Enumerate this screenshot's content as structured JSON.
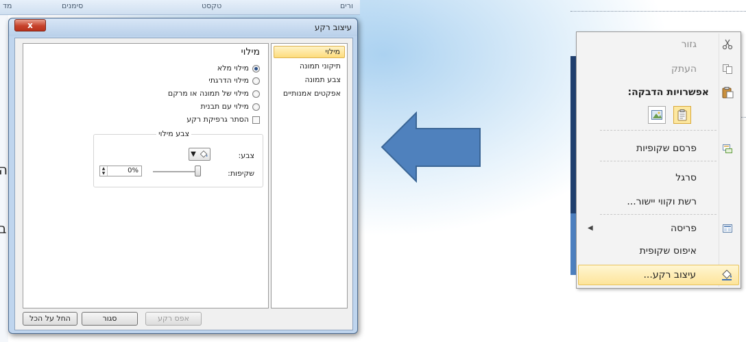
{
  "background": {
    "top_columns": [
      "מד",
      "סימנים",
      "טקסט",
      "ורים"
    ],
    "left_glyphs": [
      "ה",
      "ב"
    ]
  },
  "dialog": {
    "title": "עיצוב רקע",
    "close_glyph": "x",
    "sidebar": {
      "items": [
        {
          "label": "מילוי",
          "selected": true
        },
        {
          "label": "תיקוני תמונה",
          "selected": false
        },
        {
          "label": "צבע תמונה",
          "selected": false
        },
        {
          "label": "אפקטים אמנותיים",
          "selected": false
        }
      ]
    },
    "fill": {
      "heading": "מילוי",
      "options": [
        {
          "label": "מילוי מלא",
          "checked": true
        },
        {
          "label": "מילוי הדרגתי",
          "checked": false
        },
        {
          "label": "מילוי של תמונה או מרקם",
          "checked": false
        },
        {
          "label": "מילוי עם תבנית",
          "checked": false
        }
      ],
      "hide_graphics_label": "הסתר גרפיקת רקע",
      "hide_graphics_checked": false,
      "color_group_title": "צבע מילוי",
      "color_label": "צבע:",
      "color_icon": "paint-bucket-icon",
      "transparency_label": "שקיפות:",
      "transparency_value": "0%",
      "transparency_fraction": 0
    },
    "buttons": {
      "reset": "אפס רקע",
      "close": "סגור",
      "apply_all": "החל על הכל"
    }
  },
  "context_menu": {
    "items": [
      {
        "label": "גזור",
        "icon": "scissors-icon",
        "disabled": true
      },
      {
        "label": "העתק",
        "icon": "copy-icon",
        "disabled": true
      },
      {
        "label": "אפשרויות הדבקה:",
        "icon": "clipboard-icon",
        "bold": true
      },
      {
        "label": "פרסם שקופיות",
        "icon": "publish-icon"
      },
      {
        "label": "סרגל"
      },
      {
        "label": "רשת וקווי יישור..."
      },
      {
        "label": "פריסה",
        "icon": "layout-icon",
        "has_submenu": true
      },
      {
        "label": "איפוס שקופית"
      },
      {
        "label": "עיצוב רקע...",
        "icon": "paint-bucket-icon",
        "highlighted": true
      }
    ]
  },
  "arrow": {
    "direction": "left",
    "color": "#4f81bd"
  }
}
